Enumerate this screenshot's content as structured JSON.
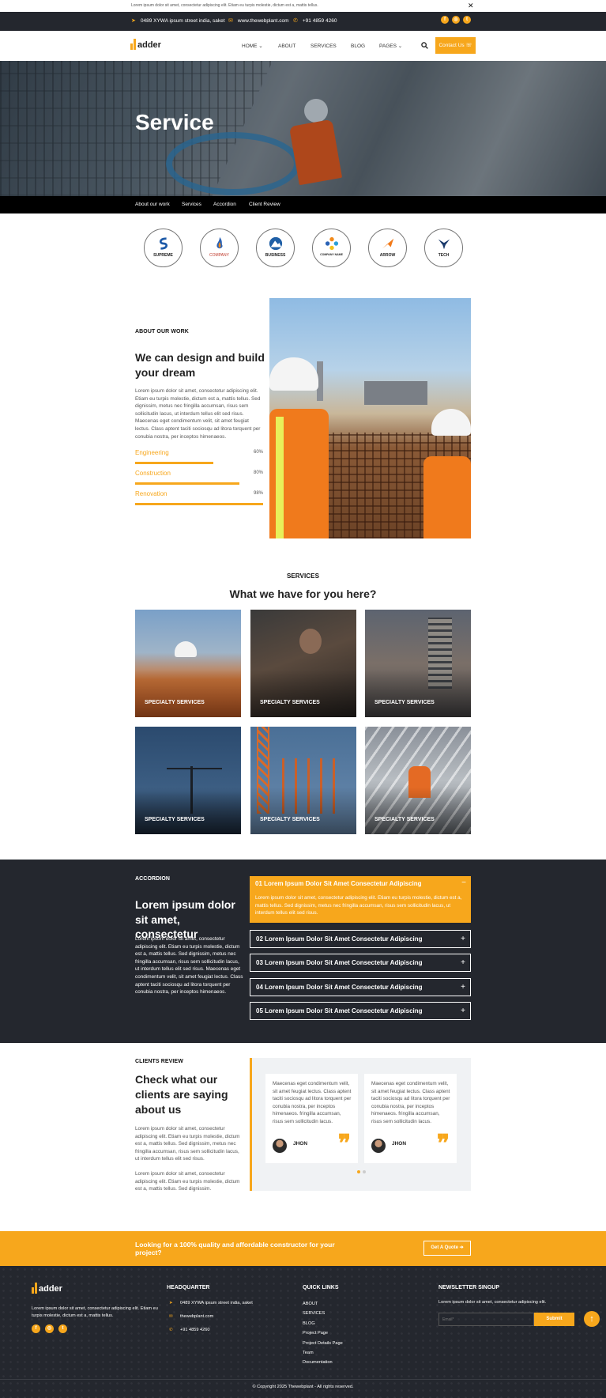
{
  "announcement": {
    "text": "Lorem ipsum dolor sit amet, consectetur adipiscing elit. Etiam eu turpis molestie, dictum est a, mattis tellus.",
    "close": "✕"
  },
  "topbar": {
    "address": "0489 XYWA ipsum street india, saket",
    "website": "www.thewebplant.com",
    "phone": "+91 4859 4260",
    "social": [
      "f",
      "◎",
      "t"
    ]
  },
  "header": {
    "logo_text": "adder",
    "nav": [
      "HOME ⌄",
      "ABOUT",
      "SERVICES",
      "BLOG",
      "PAGES ⌄"
    ],
    "contact_label": "Contact Us ☏"
  },
  "hero": {
    "title": "Service"
  },
  "subnav": [
    "About our work",
    "Services",
    "Accordion",
    "Client Review"
  ],
  "brands": [
    {
      "name": "SUPREME",
      "icon": "s-swoosh"
    },
    {
      "name": "COMPANY",
      "icon": "flame"
    },
    {
      "name": "BUSINESS",
      "icon": "mountain"
    },
    {
      "name": "COMPANY NAME",
      "icon": "flower"
    },
    {
      "name": "ARROW",
      "icon": "arrow"
    },
    {
      "name": "TECH",
      "icon": "bird"
    }
  ],
  "about": {
    "eyebrow": "ABOUT OUR WORK",
    "title": "We can design and build your dream",
    "body": "Lorem ipsum dolor sit amet, consectetur adipiscing elit. Etiam eu turpis molestie, dictum est a, mattis tellus. Sed dignissim, metus nec fringilla accumsan, risus sem sollicitudin lacus, ut interdum tellus elit sed risus. Maecenas eget condimentum velit, sit amet feugiat lectus. Class aptent taciti sociosqu ad litora torquent per conubia nostra, per inceptos himenaeos.",
    "skills": [
      {
        "label": "Engineering",
        "pct_text": "60%",
        "value": 0.6
      },
      {
        "label": "Construction",
        "pct_text": "80%",
        "value": 0.8
      },
      {
        "label": "Renovation",
        "pct_text": "98%",
        "value": 0.98
      }
    ]
  },
  "services": {
    "eyebrow": "SERVICES",
    "title": "What we have for you here?",
    "items": [
      "SPECIALTY SERVICES",
      "SPECIALTY SERVICES",
      "SPECIALTY SERVICES",
      "SPECIALTY SERVICES",
      "SPECIALTY SERVICES",
      "SPECIALTY SERVICES"
    ]
  },
  "accordion": {
    "eyebrow": "ACCORDION",
    "title": "Lorem ipsum dolor sit amet, consectetur",
    "body": "Lorem ipsum dolor sit amet, consectetur adipiscing elit. Etiam eu turpis molestie, dictum est a, mattis tellus. Sed dignissim, metus nec fringilla accumsan, risus sem sollicitudin lacus, ut interdum tellus elit sed risus. Maecenas eget condimentum velit, sit amet feugiat lectus. Class aptent taciti sociosqu ad litora torquent per conubia nostra, per inceptos himenaeos.",
    "open": {
      "title": "01 Lorem Ipsum Dolor Sit Amet Consectetur Adipiscing",
      "toggle": "−",
      "body": "Lorem ipsum dolor sit amet, consectetur adipiscing elit. Etiam eu turpis molestie, dictum est a, mattis tellus. Sed dignissim, metus nec fringilla accumsan, risus sem sollicitudin lacus, ut interdum tellus elit sed risus."
    },
    "items": [
      {
        "title": "02 Lorem Ipsum Dolor Sit Amet Consectetur Adipiscing",
        "toggle": "+"
      },
      {
        "title": "03 Lorem Ipsum Dolor Sit Amet Consectetur Adipiscing",
        "toggle": "+"
      },
      {
        "title": "04 Lorem Ipsum Dolor Sit Amet Consectetur Adipiscing",
        "toggle": "+"
      },
      {
        "title": "05 Lorem Ipsum Dolor Sit Amet Consectetur Adipiscing",
        "toggle": "+"
      }
    ]
  },
  "review": {
    "eyebrow": "CLIENTS REVIEW",
    "title": "Check what our clients are saying about us",
    "body1": "Lorem ipsum dolor sit amet, consectetur adipiscing elit. Etiam eu turpis molestie, dictum est a, mattis tellus. Sed dignissim, metus nec fringilla accumsan, risus sem sollicitudin lacus, ut interdum tellus elit sed risus.",
    "body2": "Lorem ipsum dolor sit amet, consectetur adipiscing elit. Etiam eu turpis molestie, dictum est a, mattis tellus. Sed dignissim.",
    "cards": [
      {
        "text": "Maecenas eget condimentum velit, sit amet feugiat lectus. Class aptent taciti sociosqu ad litora torquent per conubia nostra, per inceptos himenaeos. fringilla accumsan, risus sem sollicitudin lacus.",
        "name": "JHON",
        "quote": "❞"
      },
      {
        "text": "Maecenas eget condimentum velit, sit amet feugiat lectus. Class aptent taciti sociosqu ad litora torquent per conubia nostra, per inceptos himenaeos. fringilla accumsan, risus sem sollicitudin lacus.",
        "name": "JHON",
        "quote": "❞"
      }
    ]
  },
  "cta": {
    "text": "Looking for a 100% quality and affordable constructor for your project?",
    "button": "Get A Quote ➔"
  },
  "footer": {
    "logo_text": "adder",
    "about": "Lorem ipsum dolor sit amet, consectetur adipiscing elit. Etiam eu turpis molestie, dictum est a, mattis tellus.",
    "social": [
      "f",
      "◎",
      "t"
    ],
    "hq_title": "HEADQUARTER",
    "hq_address": "0489 XYWA ipsum street india, saket",
    "hq_web": "thewebplant.com",
    "hq_phone": "+91 4859 4260",
    "links_title": "QUICK LINKS",
    "links": [
      "ABOUT",
      "SERVICES",
      "BLOG",
      "Project Page",
      "Project Details Page",
      "Team",
      "Documentation"
    ],
    "newsletter_title": "NEWSLETTER SINGUP",
    "newsletter_text": "Lorem ipsum dolor sit amet, consectetur adipiscing elit.",
    "email_placeholder": "Email*",
    "submit": "Submit",
    "copyright": "© Copyright 2025 Thewebplant - All rights reserved.",
    "to_top": "↑"
  },
  "colors": {
    "accent": "#f7a71c",
    "dark": "#24272e"
  }
}
